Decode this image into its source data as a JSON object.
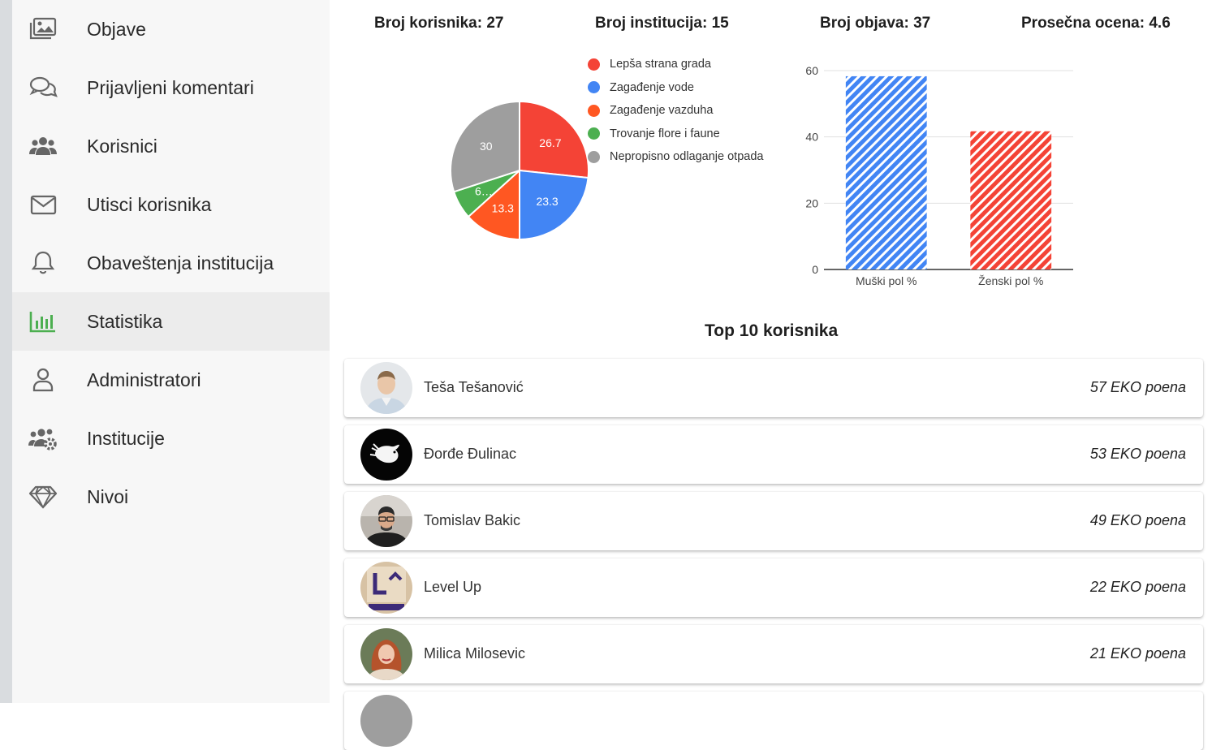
{
  "sidebar": {
    "items": [
      {
        "label": "Objave",
        "icon": "images-icon"
      },
      {
        "label": "Prijavljeni komentari",
        "icon": "comments-icon"
      },
      {
        "label": "Korisnici",
        "icon": "users-icon"
      },
      {
        "label": "Utisci korisnika",
        "icon": "envelope-icon"
      },
      {
        "label": "Obaveštenja institucija",
        "icon": "bell-icon"
      },
      {
        "label": "Statistika",
        "icon": "chart-bar-icon",
        "active": true
      },
      {
        "label": "Administratori",
        "icon": "user-icon"
      },
      {
        "label": "Institucije",
        "icon": "users-cog-icon"
      },
      {
        "label": "Nivoi",
        "icon": "gem-icon"
      }
    ]
  },
  "stats": {
    "users": "Broj korisnika: 27",
    "institutions": "Broj institucija: 15",
    "posts": "Broj objava: 37",
    "rating": "Prosečna ocena: 4.6"
  },
  "chart_data": [
    {
      "type": "pie",
      "categories": [
        "Lepša strana grada",
        "Zagađenje vode",
        "Zagađenje vazduha",
        "Trovanje flore i faune",
        "Nepropisno odlaganje otpada"
      ],
      "values": [
        26.7,
        23.3,
        13.3,
        6.7,
        30
      ],
      "slice_labels": [
        "26.7",
        "23.3",
        "13.3",
        "6…",
        "30"
      ],
      "colors": [
        "#f44336",
        "#4285f4",
        "#ff5722",
        "#4caf50",
        "#9e9e9e"
      ],
      "legend": "right"
    },
    {
      "type": "bar",
      "categories": [
        "Muški pol %",
        "Ženski pol %"
      ],
      "values": [
        58.3,
        41.7
      ],
      "colors": [
        "#4285f4",
        "#f44336"
      ],
      "pattern": "diagonal-stripes",
      "ylim": [
        0,
        60
      ],
      "yticks": [
        0,
        20,
        40,
        60
      ],
      "grid": true
    }
  ],
  "top_users": {
    "title": "Top 10 korisnika",
    "items": [
      {
        "name": "Teša Tešanović",
        "points": "57 EKO poena"
      },
      {
        "name": "Đorđe Đulinac",
        "points": "53 EKO poena"
      },
      {
        "name": "Tomislav Bakic",
        "points": "49 EKO poena"
      },
      {
        "name": "Level Up",
        "points": "22 EKO poena"
      },
      {
        "name": "Milica Milosevic",
        "points": "21 EKO poena"
      }
    ]
  }
}
